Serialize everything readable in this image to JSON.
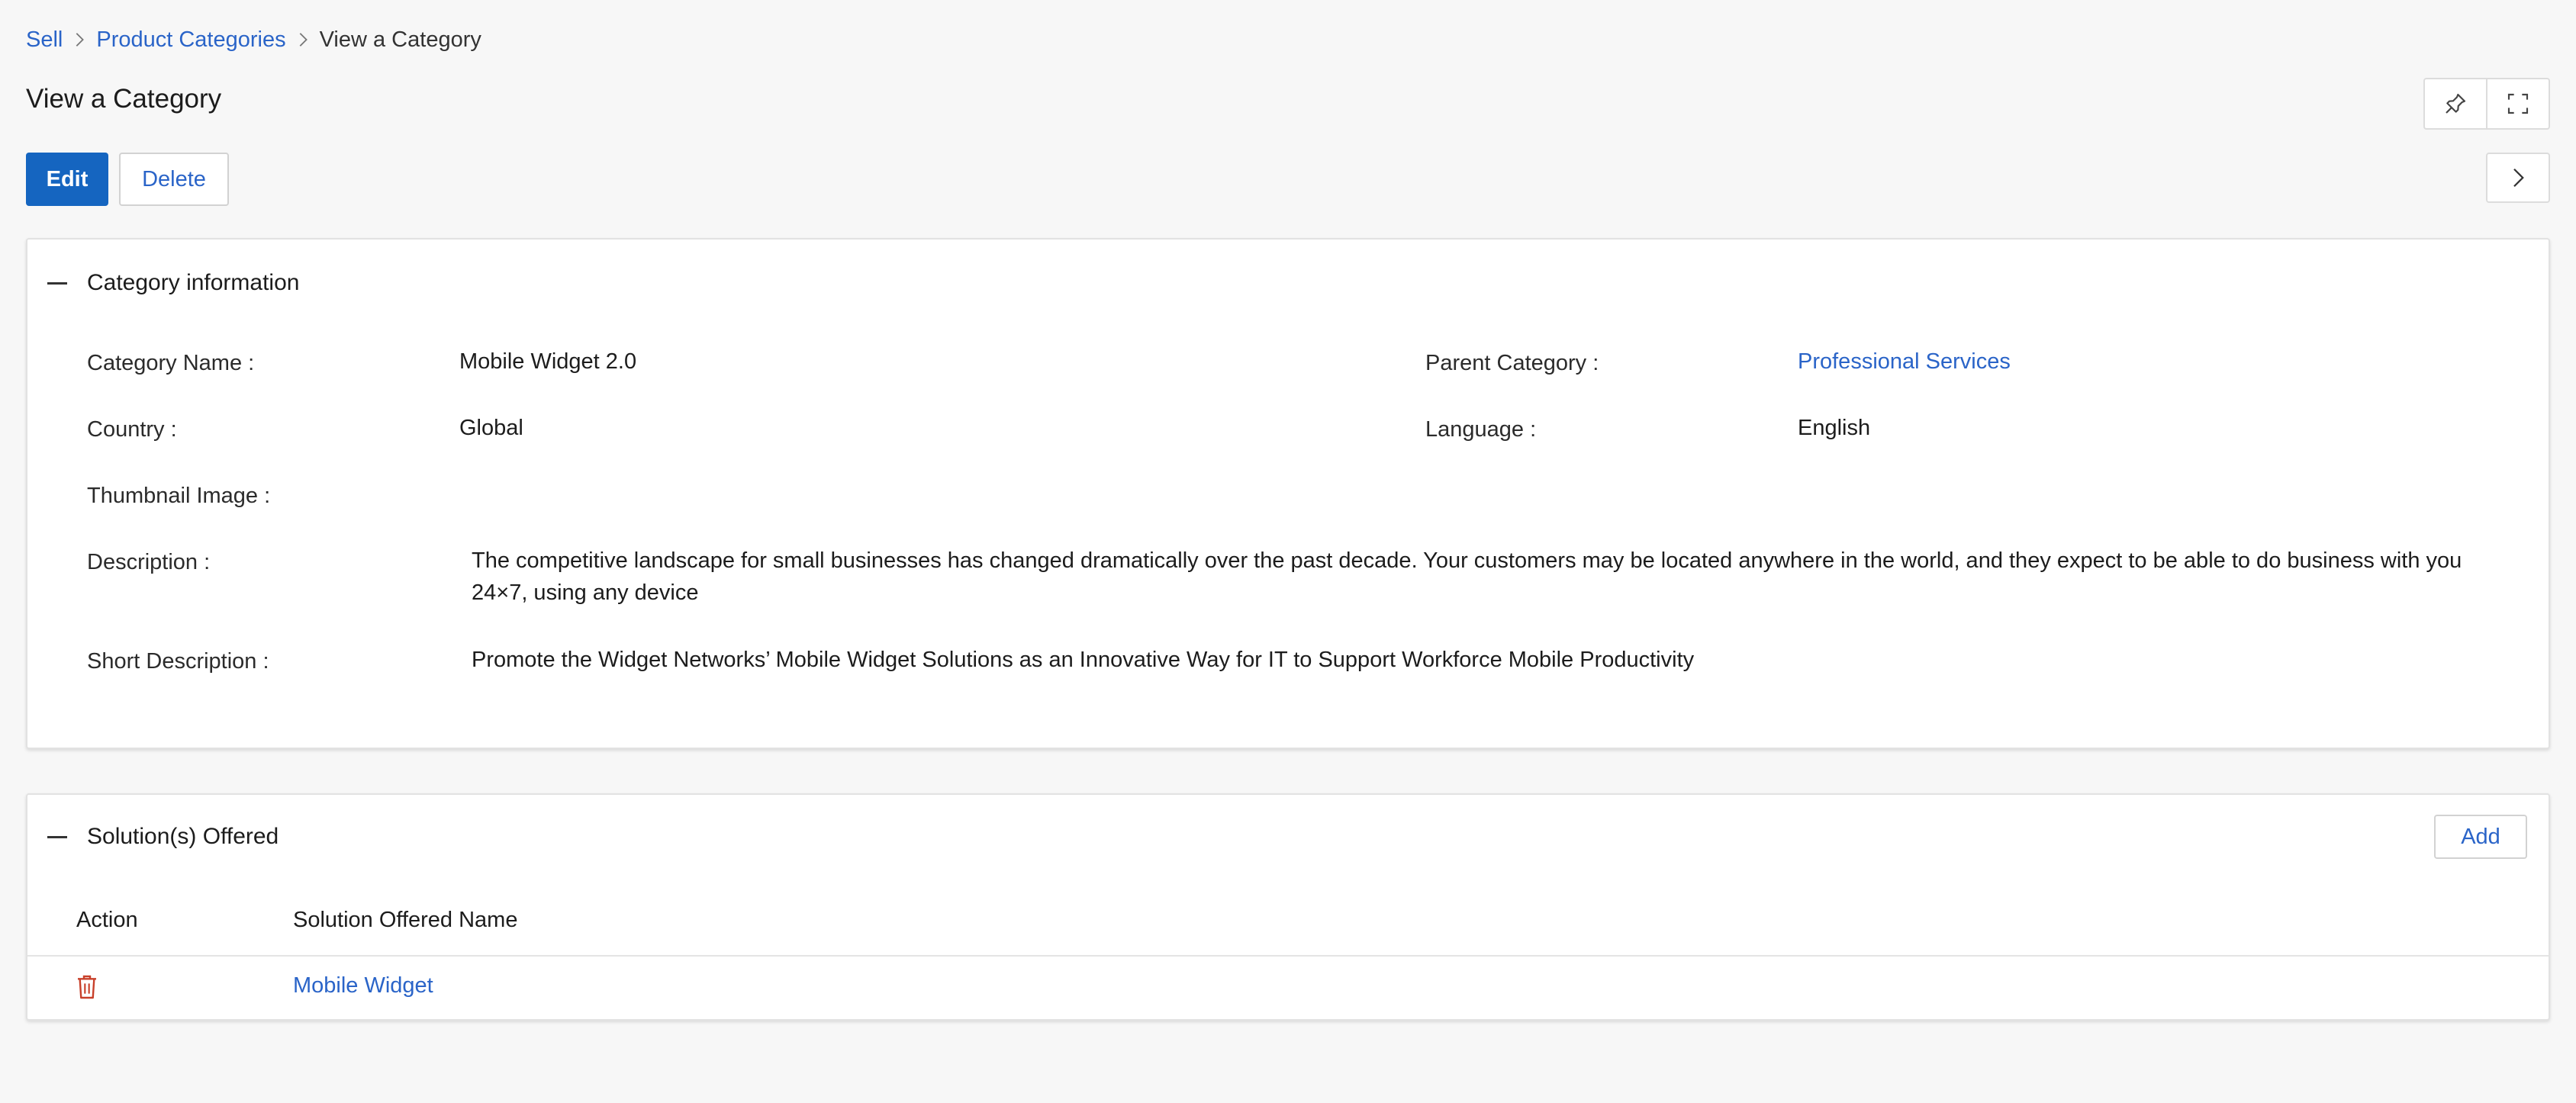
{
  "breadcrumb": {
    "items": [
      "Sell",
      "Product Categories"
    ],
    "current": "View a Category"
  },
  "page": {
    "title": "View a Category"
  },
  "toolbar": {
    "edit_label": "Edit",
    "delete_label": "Delete",
    "pin_icon": "pin-icon",
    "fullscreen_icon": "fullscreen-icon",
    "next_icon": "chevron-right-icon"
  },
  "category_info": {
    "header": "Category information",
    "category_name_label": "Category Name :",
    "category_name_value": "Mobile Widget 2.0",
    "parent_category_label": "Parent Category :",
    "parent_category_value": "Professional Services",
    "country_label": "Country :",
    "country_value": "Global",
    "language_label": "Language :",
    "language_value": "English",
    "thumbnail_label": "Thumbnail Image :",
    "description_label": "Description :",
    "description_value": "The competitive landscape for small businesses has changed dramatically over the past decade. Your customers may be located anywhere in the world, and they expect to be able to do business with you 24×7, using any device",
    "short_description_label": "Short Description :",
    "short_description_value": "Promote the Widget Networks’ Mobile Widget Solutions as an Innovative Way for IT to Support Workforce Mobile Productivity"
  },
  "solutions": {
    "header": "Solution(s) Offered",
    "add_label": "Add",
    "columns": [
      "Action",
      "Solution Offered Name"
    ],
    "rows": [
      {
        "name": "Mobile Widget"
      }
    ]
  },
  "colors": {
    "primary": "#1565c0",
    "link": "#2a64c8",
    "danger": "#c8402a"
  }
}
